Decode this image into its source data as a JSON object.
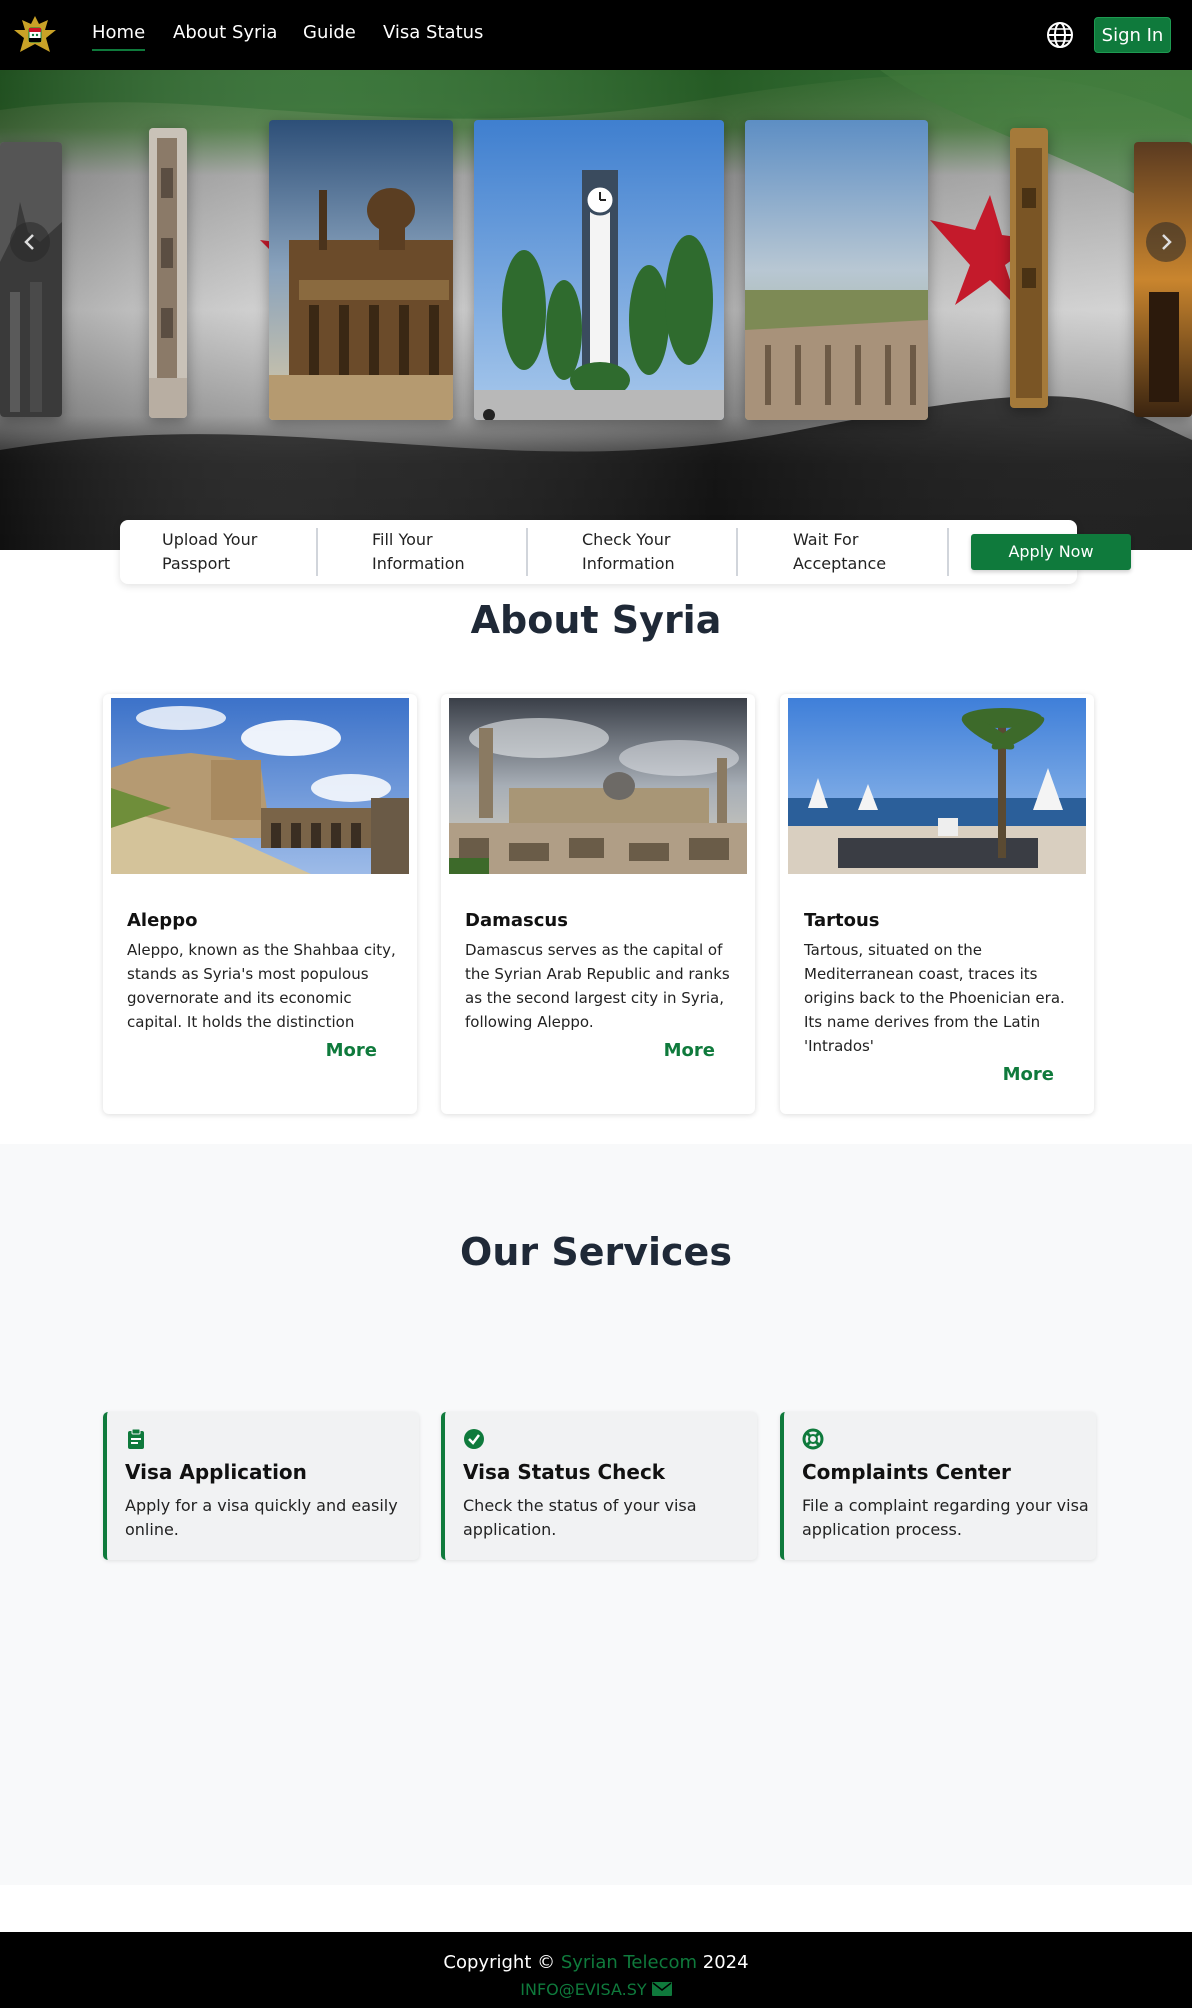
{
  "colors": {
    "brand_green": "#0f7a3c",
    "nav_bg": "#000000",
    "services_bg": "#f8f9fa"
  },
  "nav": {
    "logo_icon": "syrian-eagle-emblem",
    "links": [
      "Home",
      "About Syria",
      "Guide",
      "Visa Status"
    ],
    "active": "Home",
    "language_icon": "globe-icon",
    "signin_label": "Sign In"
  },
  "hero": {
    "background": "syrian-flag",
    "slides": [
      "ruins-left",
      "minaret-ruins",
      "umayyad-mosque",
      "homs-clock-tower",
      "roman-theatre",
      "old-tower",
      "sunset-ruins"
    ],
    "prev_icon": "chevron-left-icon",
    "next_icon": "chevron-right-icon"
  },
  "steps": [
    {
      "label": "Upload Your Passport"
    },
    {
      "label": "Fill Your Information"
    },
    {
      "label": "Check Your Information"
    },
    {
      "label": "Wait For Acceptance"
    }
  ],
  "apply_label": "Apply Now",
  "about": {
    "title": "About Syria",
    "cards": [
      {
        "name": "Aleppo",
        "image": "aleppo-citadel",
        "text": "Aleppo, known as the Shahbaa city, stands as Syria's most populous governorate and its economic capital. It holds the distinction",
        "more": "More"
      },
      {
        "name": "Damascus",
        "image": "damascus-umayyad-mosque",
        "text": "Damascus serves as the capital of the Syrian Arab Republic and ranks as the second largest city in Syria, following Aleppo.",
        "more": "More"
      },
      {
        "name": "Tartous",
        "image": "tartous-beach",
        "text": "Tartous, situated on the Mediterranean coast, traces its origins back to the Phoenician era. Its name derives from the Latin 'Intrados'",
        "more": "More"
      }
    ]
  },
  "services": {
    "title": "Our Services",
    "items": [
      {
        "title": "Visa Application",
        "desc": "Apply for a visa quickly and easily online.",
        "icon": "clipboard-icon"
      },
      {
        "title": "Visa Status Check",
        "desc": "Check the status of your visa application.",
        "icon": "check-circle-icon"
      },
      {
        "title": "Complaints Center",
        "desc": "File a complaint regarding your visa application process.",
        "icon": "lifebuoy-icon"
      }
    ]
  },
  "footer": {
    "copyright_prefix": "Copyright ©",
    "company": "Syrian Telecom",
    "year": "2024",
    "email": "INFO@EVISA.SY",
    "email_icon": "envelope-icon"
  }
}
